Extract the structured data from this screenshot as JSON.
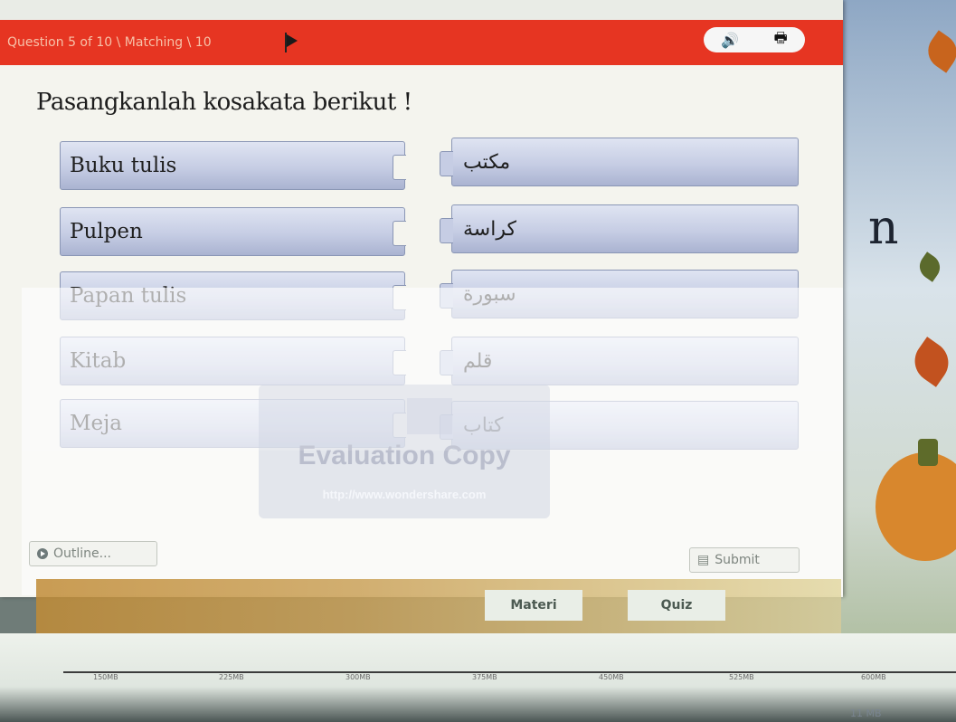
{
  "header": {
    "question_info": "Question 5 of 10 \\ Matching \\ 10",
    "icons": [
      "flag-icon",
      "speaker-icon",
      "print-icon"
    ]
  },
  "prompt": "Pasangkanlah kosakata berikut !",
  "pairs": [
    {
      "left": "Buku tulis",
      "right": "مكتب"
    },
    {
      "left": "Pulpen",
      "right": "كراسة"
    },
    {
      "left": "Papan tulis",
      "right": "سبورة"
    },
    {
      "left": "Kitab",
      "right": "قلم"
    },
    {
      "left": "Meja",
      "right": "كتاب"
    }
  ],
  "watermark": {
    "title": "Evaluation Copy",
    "url": "http://www.wondershare.com"
  },
  "buttons": {
    "outline": "Outline...",
    "submit": "Submit"
  },
  "nav_tabs": [
    "Materi",
    "Quiz"
  ],
  "memory_ticks": [
    "150MB",
    "225MB",
    "300MB",
    "375MB",
    "450MB",
    "525MB",
    "600MB"
  ],
  "memory_total": "11 MB",
  "colors": {
    "header": "#e63522",
    "tile": "#c6cde4"
  }
}
